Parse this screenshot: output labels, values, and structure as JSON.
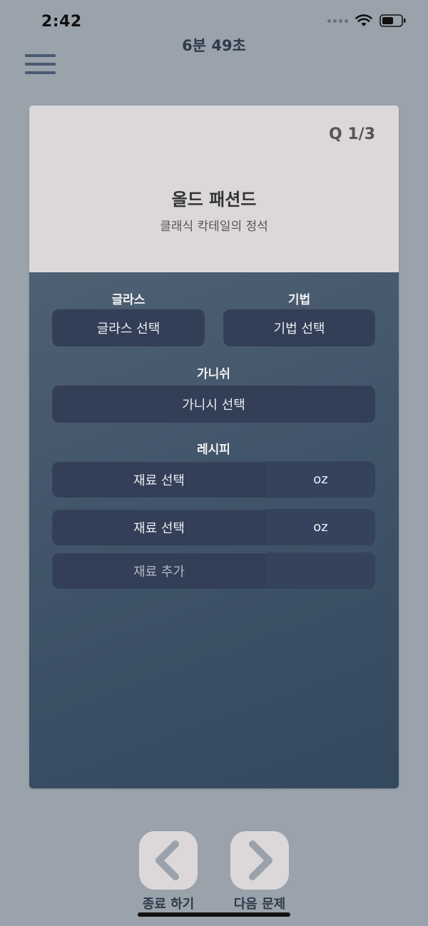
{
  "status_bar": {
    "time": "2:42"
  },
  "header": {
    "timer": "6분 49초",
    "menu_icon": "hamburger-menu-icon"
  },
  "question": {
    "counter": "Q 1/3",
    "cocktail_name": "올드 패션드",
    "description": "클래식 칵테일의 정석"
  },
  "form": {
    "glass_label": "글라스",
    "glass_button": "글라스 선택",
    "method_label": "기법",
    "method_button": "기법 선택",
    "garnish_label": "가니쉬",
    "garnish_button": "가니시 선택",
    "recipe_label": "레시피",
    "recipe_rows": [
      {
        "ingredient": "재료 선택",
        "unit": "oz"
      },
      {
        "ingredient": "재료 선택",
        "unit": "oz"
      }
    ],
    "add_ingredient": "재료 추가"
  },
  "footer": {
    "quit_label": "종료 하기",
    "next_label": "다음 문제",
    "quit_icon": "chevron-left-icon",
    "next_icon": "chevron-right-icon"
  },
  "colors": {
    "background": "#9aa2ab",
    "card_header": "#dcd8d9",
    "card_body": "#42556a",
    "button": "#323f57",
    "text_dark": "#2f3a4a"
  }
}
